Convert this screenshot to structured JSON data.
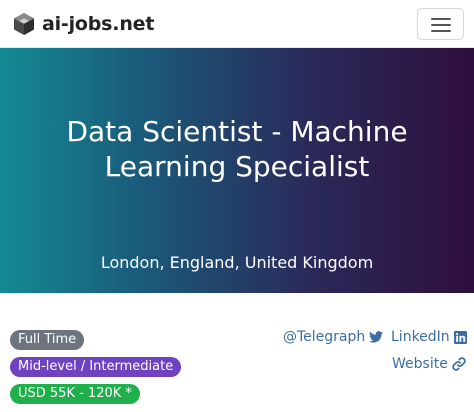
{
  "brand": {
    "name": "ai-jobs.net"
  },
  "hero": {
    "title_line1": "Data Scientist - Machine",
    "title_line2": "Learning Specialist",
    "location": "London, England, United Kingdom"
  },
  "badges": [
    {
      "label": "Full Time",
      "color": "#6c757d"
    },
    {
      "label": "Mid-level / Intermediate",
      "color": "#6f42c1"
    },
    {
      "label": "USD 55K - 120K *",
      "color": "#20b04b"
    }
  ],
  "links": {
    "company": "@Telegraph",
    "company_icon": "twitter-icon",
    "linkedin": "LinkedIn",
    "linkedin_icon": "linkedin-icon",
    "website": "Website",
    "website_icon": "link-icon"
  },
  "colors": {
    "hero_gradient_start": "#148a94",
    "hero_gradient_end": "#2e0f3c",
    "link": "#3a6ea5"
  }
}
